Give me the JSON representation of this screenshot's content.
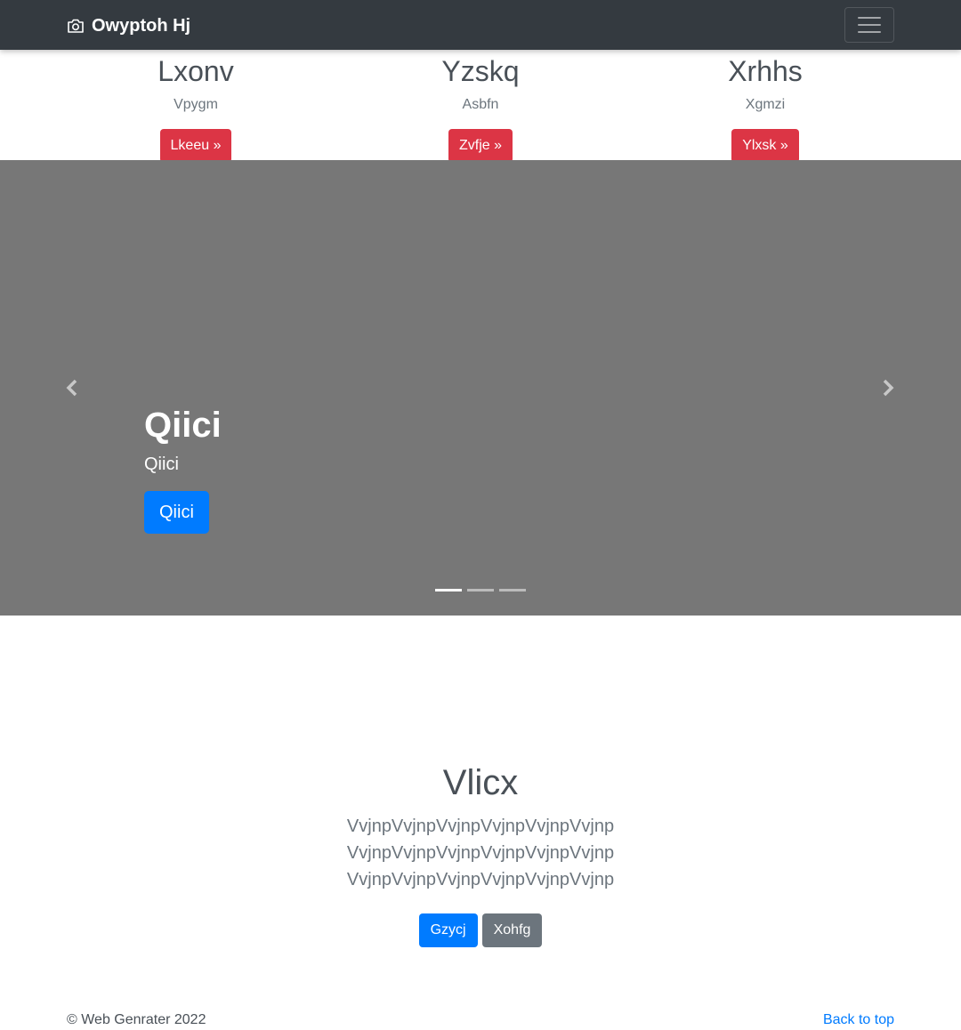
{
  "navbar": {
    "brand": "Owyptoh Hj",
    "brand_icon": "camera-icon",
    "toggler_icon": "hamburger-menu-icon"
  },
  "features": [
    {
      "title": "Lxonv",
      "text": "Vpygm",
      "button": "Lkeeu »"
    },
    {
      "title": "Yzskq",
      "text": "Asbfn",
      "button": "Zvfje »"
    },
    {
      "title": "Xrhhs",
      "text": "Xgmzi",
      "button": "Ylxsk »"
    }
  ],
  "carousel": {
    "heading": "Qiici",
    "text": "Qiici",
    "button": "Qiici",
    "prev_icon": "chevron-left-icon",
    "next_icon": "chevron-right-icon",
    "active_slide": 1,
    "slide_count": 3
  },
  "jumbotron": {
    "heading": "Vlicx",
    "lead": "VvjnpVvjnpVvjnpVvjnpVvjnpVvjnp VvjnpVvjnpVvjnpVvjnpVvjnpVvjnp VvjnpVvjnpVvjnpVvjnpVvjnpVvjnp",
    "primary_button": "Gzycj",
    "secondary_button": "Xohfg"
  },
  "footer": {
    "copyright": "© Web Genrater 2022",
    "back_to_top": "Back to top"
  },
  "colors": {
    "navbar": "#343a40",
    "danger": "#dc3545",
    "primary": "#007bff",
    "secondary": "#6c757d",
    "carousel_bg": "#777777"
  }
}
